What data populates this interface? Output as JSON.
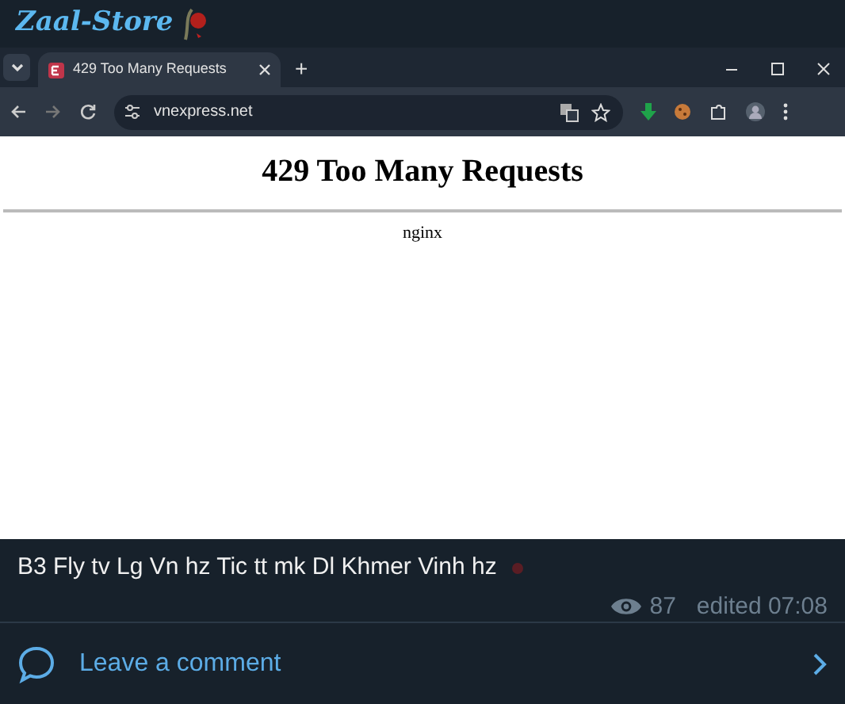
{
  "channel": {
    "title": "Zaal-Store"
  },
  "browser": {
    "tab": {
      "title": "429 Too Many Requests",
      "selected": true
    },
    "new_tab": "+",
    "url": "vnexpress.net"
  },
  "webpage": {
    "heading": "429 Too Many Requests",
    "server": "nginx"
  },
  "post": {
    "caption": "B3 Fly tv Lg Vn hz Tic tt mk Dl Khmer Vinh hz",
    "views": "87",
    "edited": "edited 07:08"
  },
  "comments": {
    "label": "Leave a comment"
  }
}
